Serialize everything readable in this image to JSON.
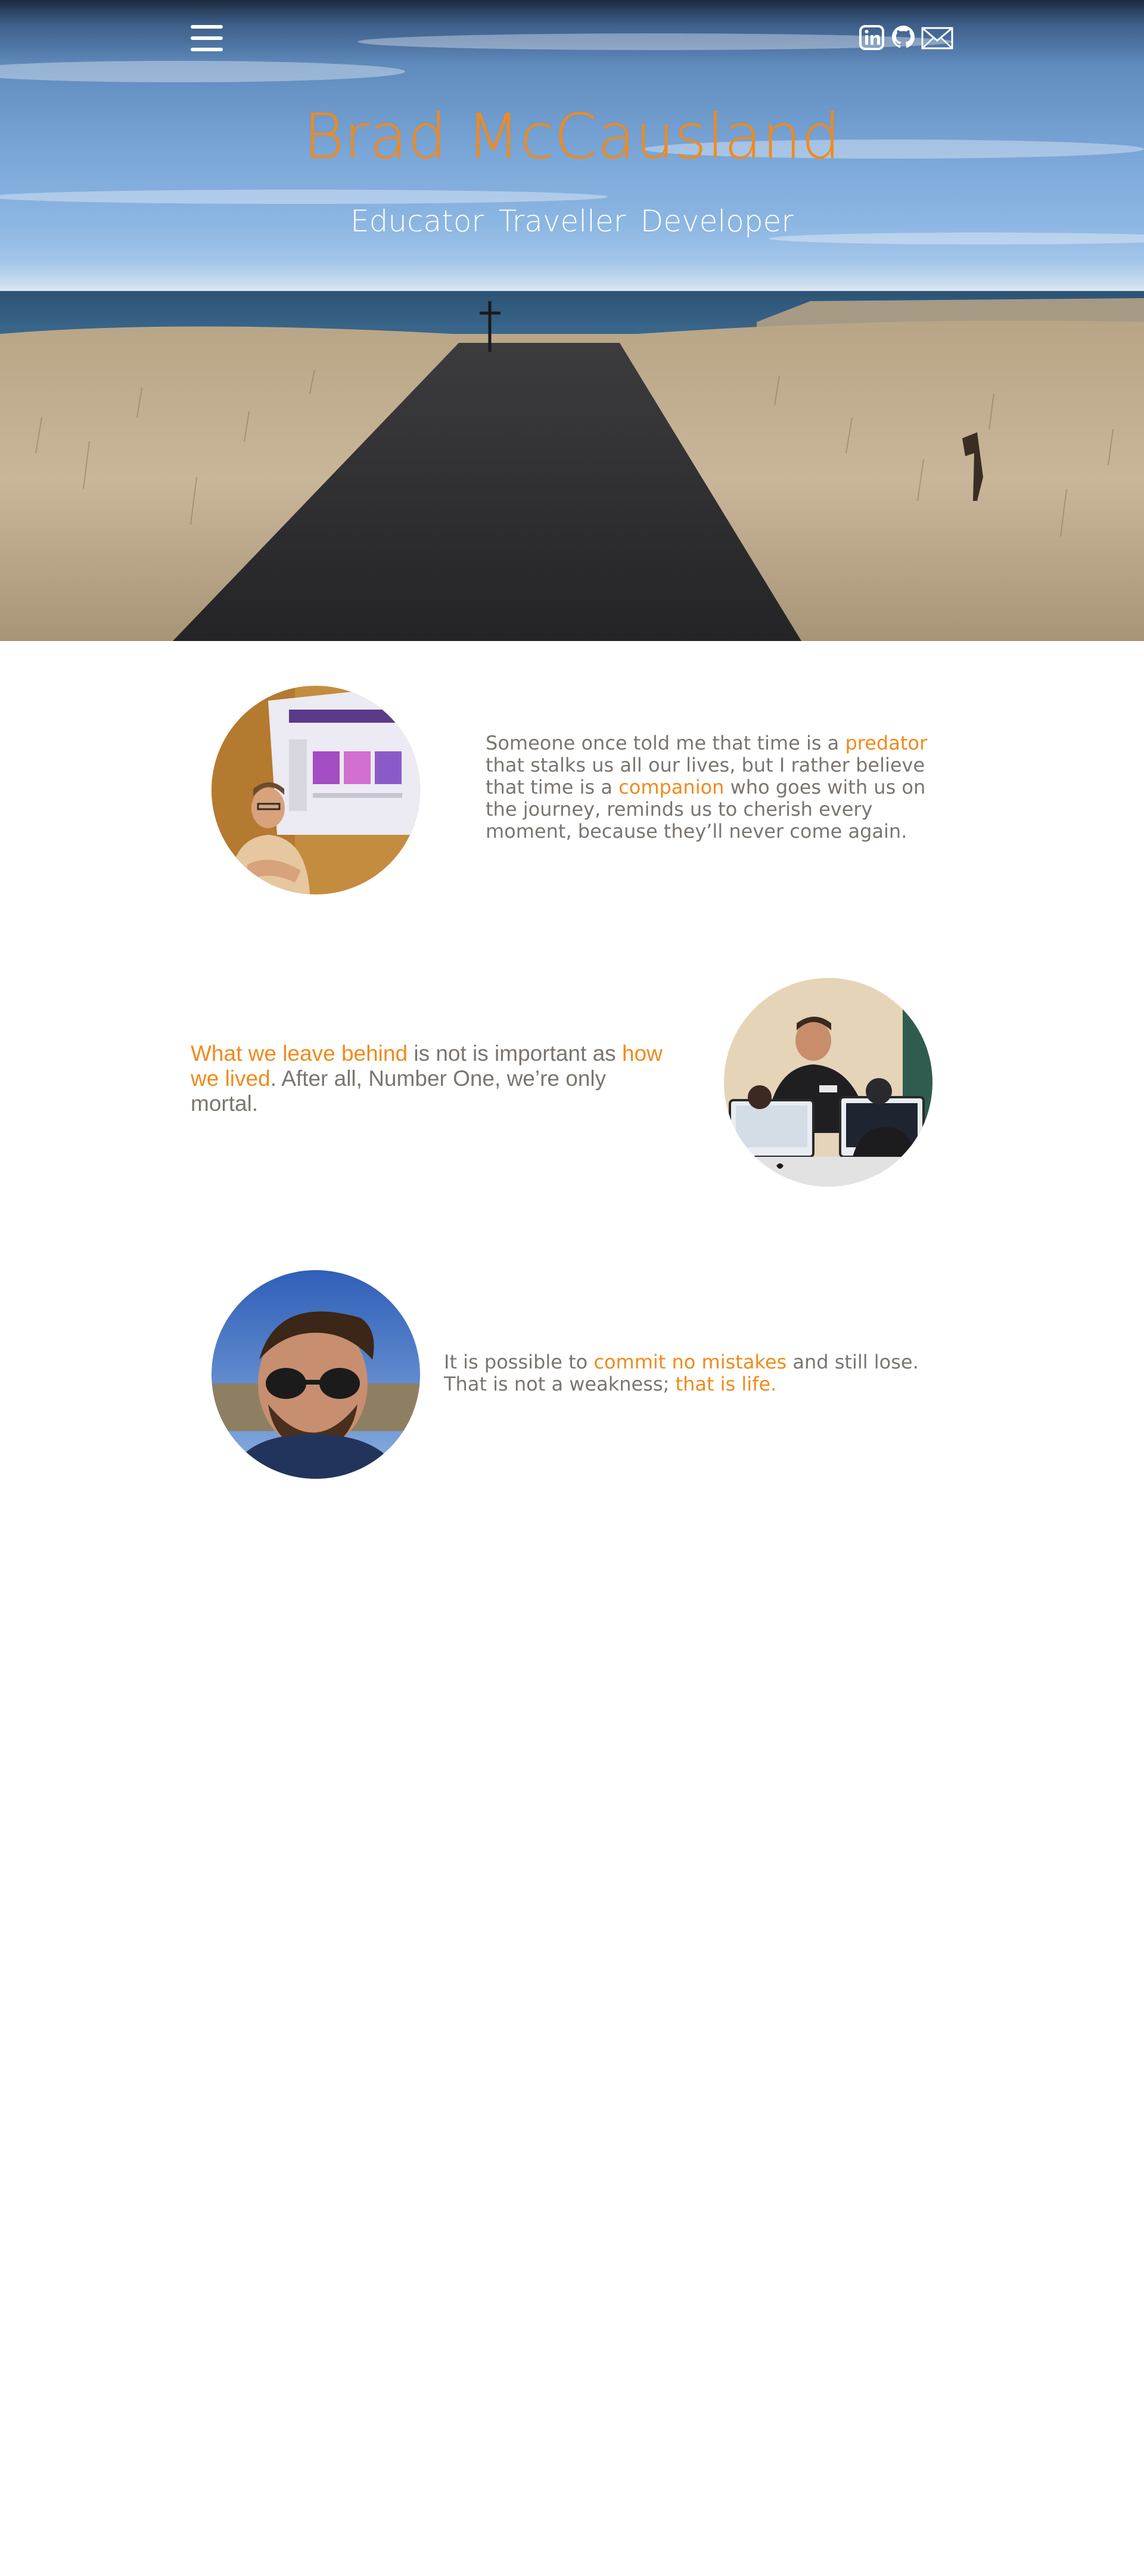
{
  "header": {
    "menu_icon": "hamburger-menu-icon",
    "social": [
      {
        "name": "LinkedIn",
        "icon": "linkedin-icon"
      },
      {
        "name": "GitHub",
        "icon": "github-icon"
      },
      {
        "name": "Email",
        "icon": "envelope-icon"
      }
    ]
  },
  "hero": {
    "title": "Brad McCausland",
    "taglines": [
      "Educator",
      "Traveller",
      "Developer"
    ],
    "background": "coastal path landscape photo"
  },
  "colors": {
    "accent": "#f08a1c",
    "body_text": "#7a7570",
    "tagline": "#ffffff"
  },
  "quotes": [
    {
      "photo": "man seated in front of projector screen",
      "parts": [
        {
          "text": "Someone once told me that time is a ",
          "highlight": false
        },
        {
          "text": "predator",
          "highlight": true
        },
        {
          "text": " that stalks us all our lives, but I rather believe that time is a ",
          "highlight": false
        },
        {
          "text": "companion",
          "highlight": true
        },
        {
          "text": " who goes with us on the journey, reminds us to cherish every moment, because they’ll never come again.",
          "highlight": false
        }
      ]
    },
    {
      "photo": "teacher helping students at computers",
      "parts": [
        {
          "text": "What we leave behind",
          "highlight": true
        },
        {
          "text": " is not is important as ",
          "highlight": false
        },
        {
          "text": "how we lived",
          "highlight": true
        },
        {
          "text": ". After all, Number One, we’re only mortal.",
          "highlight": false
        }
      ]
    },
    {
      "photo": "selfie with sunglasses outdoors",
      "parts": [
        {
          "text": "It is possible to ",
          "highlight": false
        },
        {
          "text": "commit no mistakes",
          "highlight": true
        },
        {
          "text": " and still lose. That is not a weakness; ",
          "highlight": false
        },
        {
          "text": "that is life.",
          "highlight": true
        }
      ]
    }
  ]
}
